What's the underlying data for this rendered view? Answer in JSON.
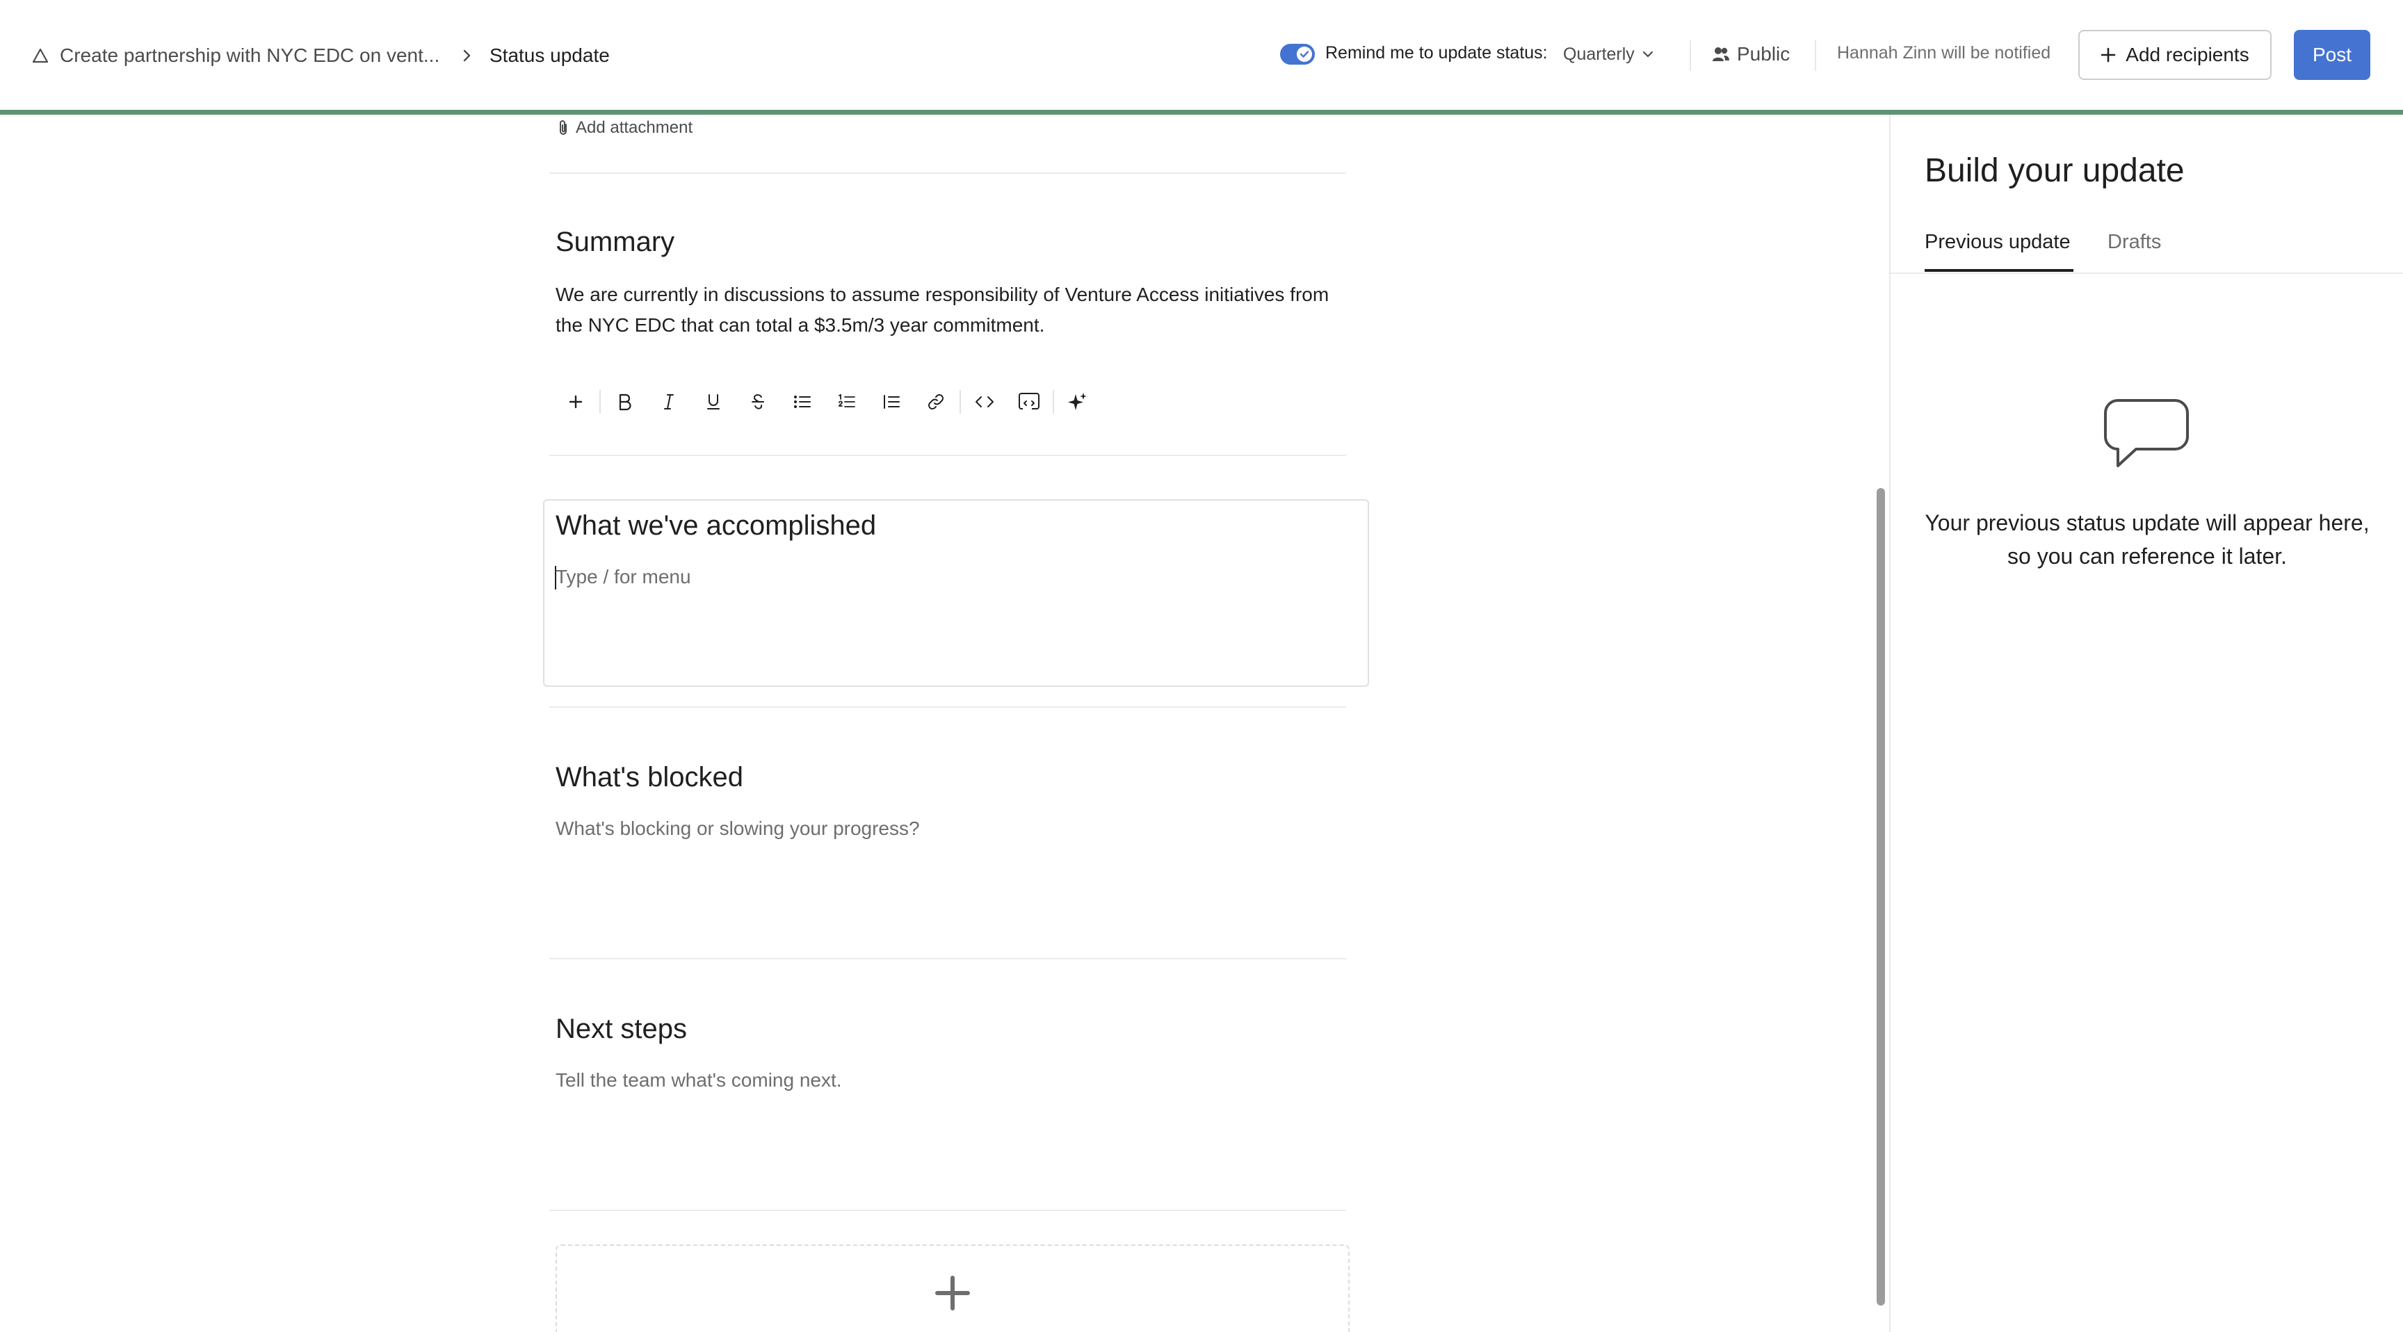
{
  "header": {
    "breadcrumb_goal": "Create partnership with NYC EDC on vent...",
    "breadcrumb_current": "Status update",
    "reminder_label": "Remind me to update status:",
    "reminder_frequency": "Quarterly",
    "visibility": "Public",
    "notify_text": "Hannah Zinn will be notified",
    "add_recipients_label": "Add recipients",
    "post_label": "Post",
    "reminder_enabled": true
  },
  "editor": {
    "add_attachment_label": "Add attachment",
    "sections": [
      {
        "title": "Summary",
        "body": "We are currently in discussions to assume responsibility of Venture Access initiatives from the NYC EDC that can total a $3.5m/3 year commitment."
      },
      {
        "title": "What we've accomplished",
        "placeholder": "Type / for menu"
      },
      {
        "title": "What's blocked",
        "placeholder": "What's blocking or slowing your progress?"
      },
      {
        "title": "Next steps",
        "placeholder": "Tell the team what's coming next."
      }
    ],
    "toolbar_icons": [
      "plus-icon",
      "bold-icon",
      "italic-icon",
      "underline-icon",
      "strikethrough-icon",
      "bullet-list-icon",
      "numbered-list-icon",
      "quote-icon",
      "link-icon",
      "code-icon",
      "code-block-icon",
      "ai-sparkle-icon"
    ]
  },
  "side_panel": {
    "title": "Build your update",
    "tabs": [
      "Previous update",
      "Drafts"
    ],
    "active_tab": "Previous update",
    "empty_message": "Your previous status update will appear here, so you can reference it later."
  },
  "colors": {
    "accent": "#4573d2",
    "progress": "#5e9373",
    "text": "#1e1f21",
    "muted": "#6d6e6f"
  }
}
